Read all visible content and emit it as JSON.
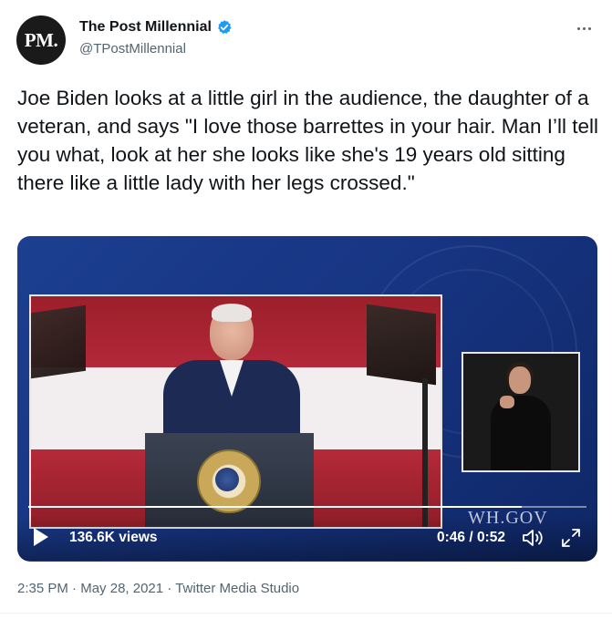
{
  "author": {
    "avatar_text": "PM.",
    "display_name": "The Post Millennial",
    "handle": "@TPostMillennial",
    "verified": true
  },
  "more_icon": "more-horizontal-icon",
  "tweet": {
    "text": "Joe Biden looks at a little girl in the audience, the daughter of a veteran, and says \"I love those barrettes in your hair. Man I’ll tell you what, look at her she looks like she's 19 years old sitting there like a little lady with her legs crossed.\""
  },
  "video": {
    "watermark": "WH.GOV",
    "views": "136.6K views",
    "time": "0:46 / 0:52",
    "progress": 0.8846,
    "play_icon": "play-icon",
    "volume_icon": "volume-icon",
    "fullscreen_icon": "fullscreen-icon"
  },
  "meta": {
    "time": "2:35 PM",
    "separator": "·",
    "date": "May 28, 2021",
    "source": "Twitter Media Studio"
  },
  "colors": {
    "verified_badge": "#1d9bf0",
    "secondary_text": "#536471",
    "primary_text": "#0f1419"
  }
}
